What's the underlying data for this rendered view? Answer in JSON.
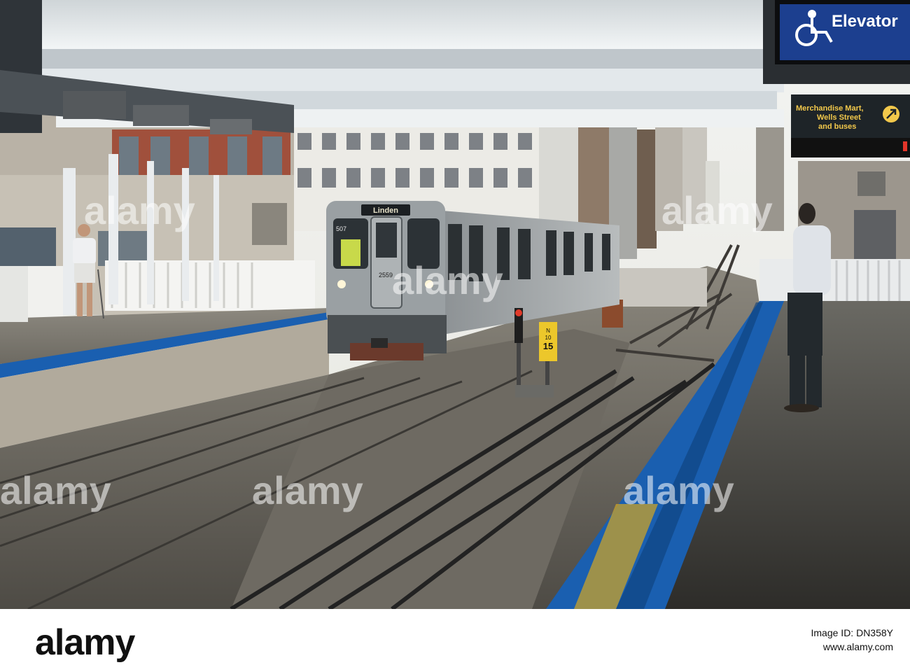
{
  "signs": {
    "elevator": "Elevator",
    "transfer_line1": "Merchandise Mart,",
    "transfer_line2": "Wells Street",
    "transfer_line3": "and buses",
    "destination": "Linden",
    "run_number": "507",
    "car_number": "2559",
    "track_marker_top": "N",
    "track_marker_mid": "10",
    "track_marker_num": "15"
  },
  "watermark": "alamy",
  "footer": {
    "brand": "alamy",
    "image_id": "Image ID: DN358Y",
    "url": "www.alamy.com"
  },
  "colors": {
    "platform_edge_blue": "#1a5fb0",
    "sign_blue": "#1c3f8f",
    "sign_dark": "#1e2428",
    "canopy": "#e7ecef"
  }
}
